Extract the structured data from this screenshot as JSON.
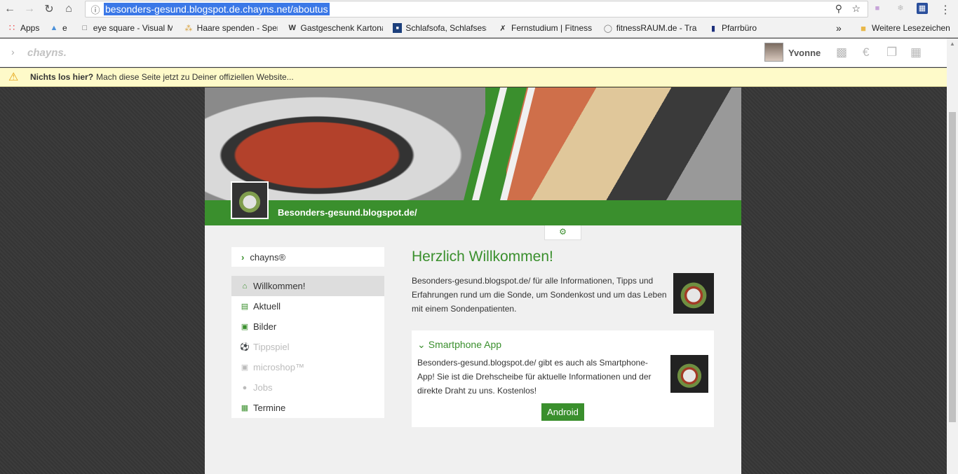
{
  "browser": {
    "url": "besonders-gesund.blogspot.de.chayns.net/aboutus",
    "bookmarks": [
      {
        "label": "Apps",
        "icon": "apps-grid-icon"
      },
      {
        "label": "e",
        "icon": "site-icon"
      },
      {
        "label": "eye square - Visual M",
        "icon": "page-icon"
      },
      {
        "label": "Haare spenden - Sper",
        "icon": "hair-icon"
      },
      {
        "label": "Gastgeschenk Kartona",
        "icon": "w-icon"
      },
      {
        "label": "Schlafsofa, Schlafsess",
        "icon": "sofa-icon"
      },
      {
        "label": "Fernstudium | Fitness",
        "icon": "fitness-icon"
      },
      {
        "label": "fitnessRAUM.de - Trai",
        "icon": "ring-icon"
      },
      {
        "label": "Pfarrbüro",
        "icon": "church-icon"
      }
    ],
    "more": "»",
    "other_bookmarks": "Weitere Lesezeichen"
  },
  "chayns": {
    "logo": "chayns.",
    "username": "Yvonne",
    "warning_bold": "Nichts los hier?",
    "warning_text": "Mach diese Seite jetzt zu Deiner offiziellen Website..."
  },
  "site": {
    "name": "Besonders-gesund.blogspot.de/"
  },
  "sidebar": {
    "header": "chayns®",
    "items": [
      {
        "label": "Willkommen!",
        "state": "active",
        "icon": "home-icon"
      },
      {
        "label": "Aktuell",
        "state": "normal",
        "icon": "news-icon"
      },
      {
        "label": "Bilder",
        "state": "normal",
        "icon": "image-icon"
      },
      {
        "label": "Tippspiel",
        "state": "disabled",
        "icon": "soccer-ball-icon"
      },
      {
        "label": "microshop™",
        "state": "disabled",
        "icon": "cart-icon"
      },
      {
        "label": "Jobs",
        "state": "disabled",
        "icon": "group-icon"
      },
      {
        "label": "Termine",
        "state": "normal",
        "icon": "calendar-icon"
      }
    ]
  },
  "main": {
    "title": "Herzlich Willkommen!",
    "intro": "Besonders-gesund.blogspot.de/ für alle Informationen, Tipps und Erfahrungen rund um die Sonde, um Sondenkost und um das Leben mit einem Sondenpatienten.",
    "app_card": {
      "title": "Smartphone App",
      "text": "Besonders-gesund.blogspot.de/ gibt es auch als Smartphone-App! Sie ist die Drehscheibe für aktuelle Informationen und der direkte Draht zu uns. Kostenlos!",
      "button": "Android"
    }
  },
  "colors": {
    "accent": "#3a8f2d",
    "warning_bg": "#fefac9"
  }
}
